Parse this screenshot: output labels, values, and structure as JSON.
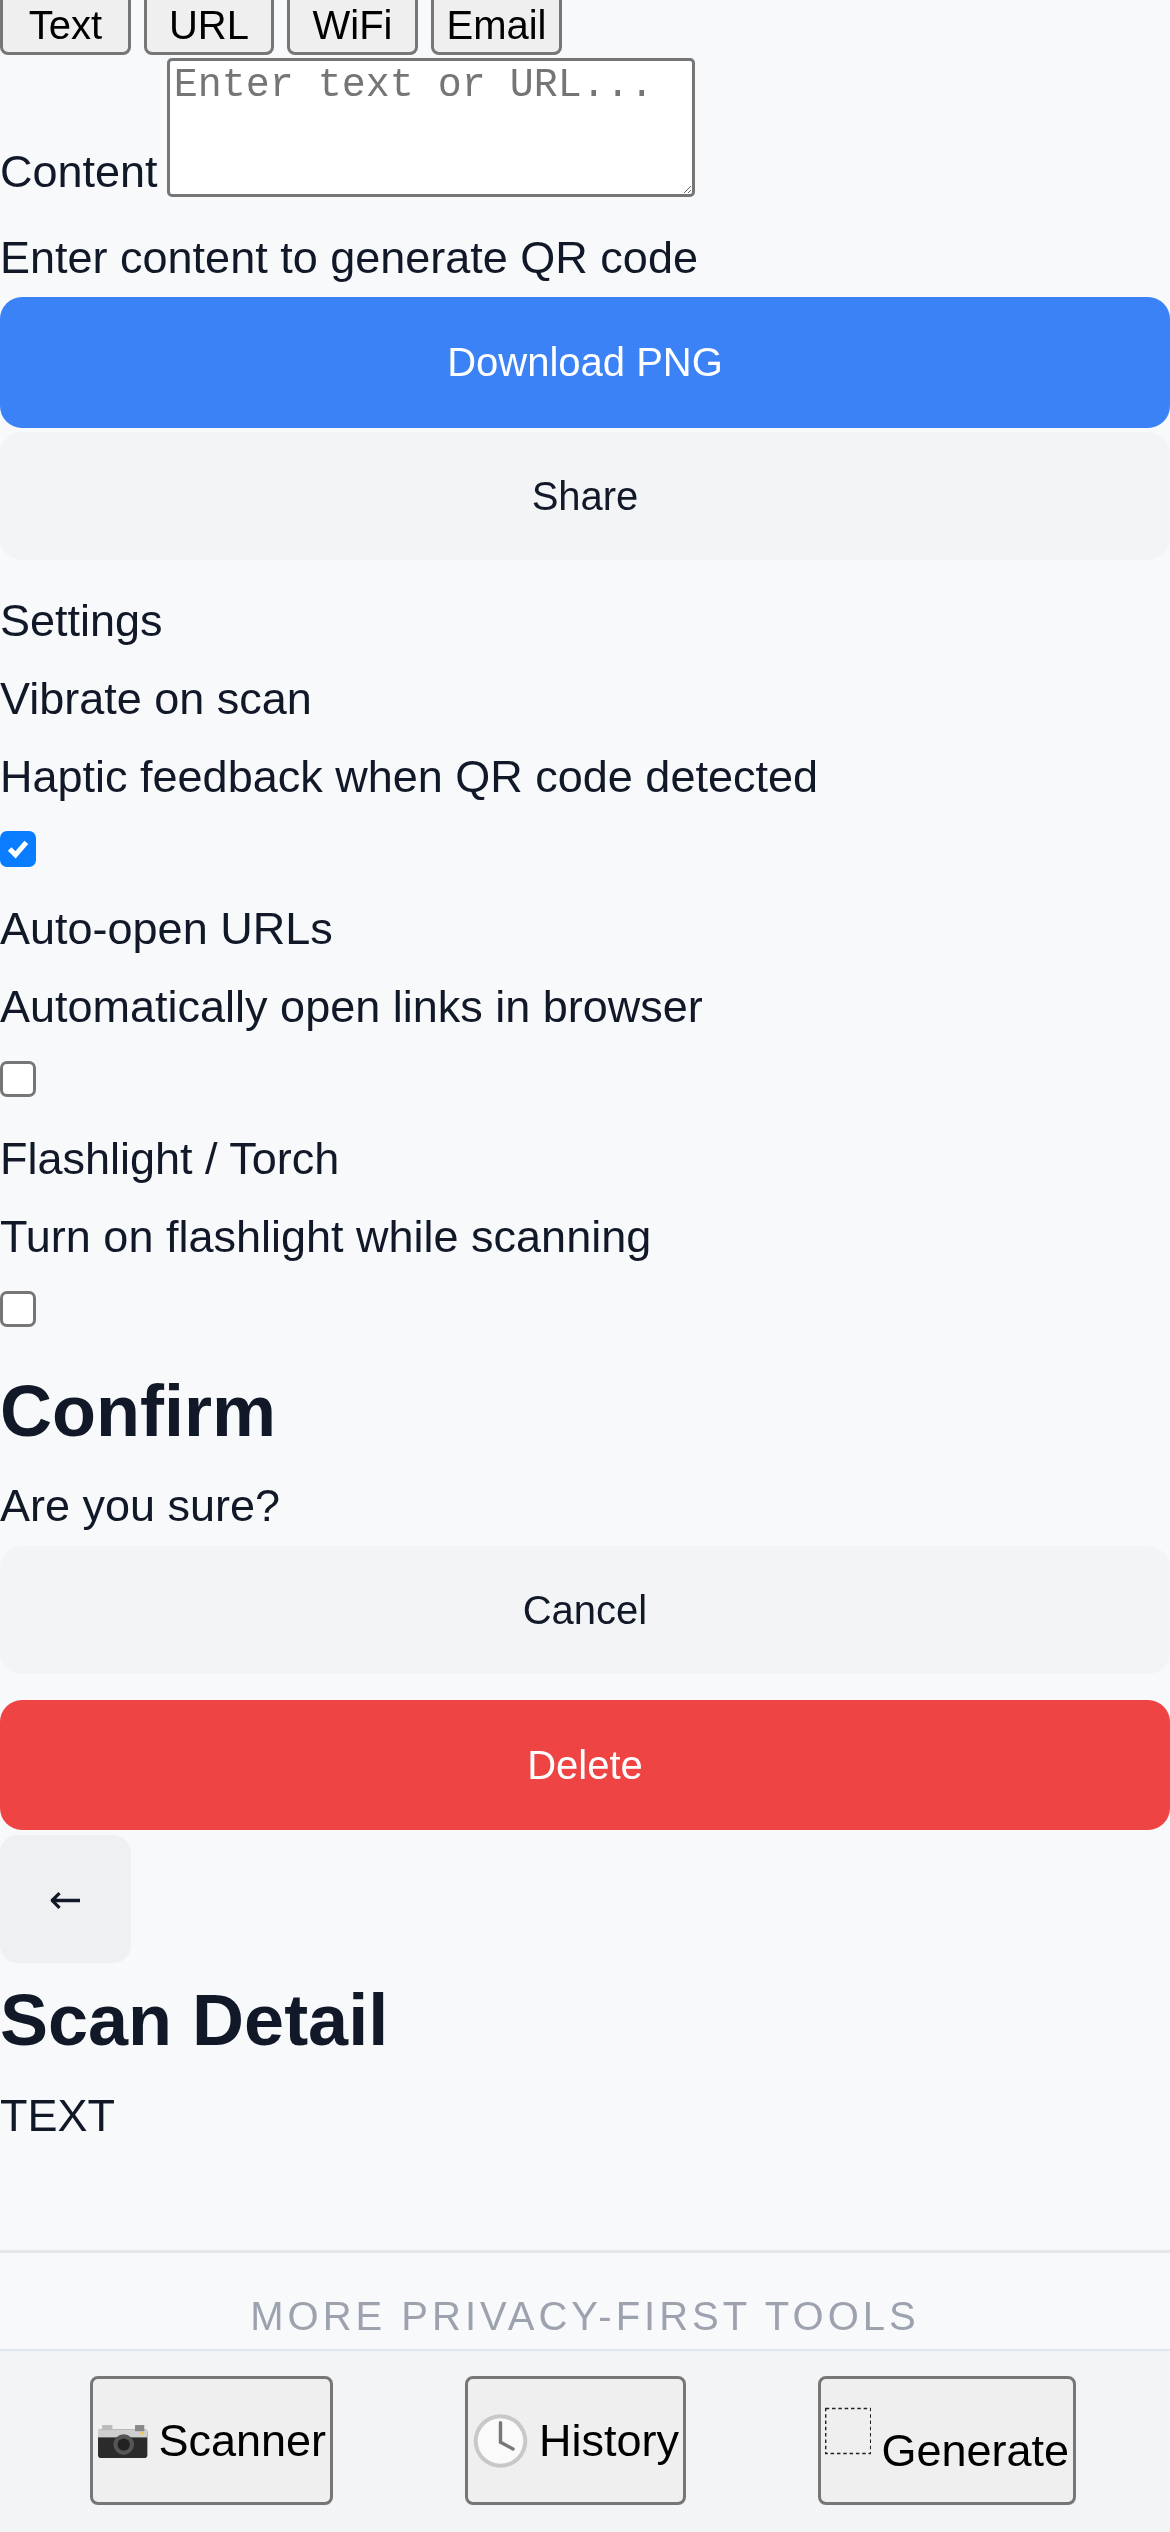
{
  "type_tabs": [
    {
      "label": "Text"
    },
    {
      "label": "URL"
    },
    {
      "label": "WiFi"
    },
    {
      "label": "Email"
    }
  ],
  "generator": {
    "content_label": "Content",
    "placeholder": "Enter text or URL...",
    "hint": "Enter content to generate QR code",
    "download_button": "Download PNG",
    "share_button": "Share"
  },
  "settings": {
    "title": "Settings",
    "items": [
      {
        "label": "Vibrate on scan",
        "description": "Haptic feedback when QR code detected",
        "checked": true
      },
      {
        "label": "Auto-open URLs",
        "description": "Automatically open links in browser",
        "checked": false
      },
      {
        "label": "Flashlight / Torch",
        "description": "Turn on flashlight while scanning",
        "checked": false
      }
    ]
  },
  "confirm_dialog": {
    "title": "Confirm",
    "message": "Are you sure?",
    "cancel_button": "Cancel",
    "delete_button": "Delete"
  },
  "scan_detail": {
    "back_button": "←",
    "title": "Scan Detail",
    "type": "TEXT"
  },
  "footer": {
    "heading": "MORE PRIVACY-FIRST TOOLS"
  },
  "bottom_nav": [
    {
      "label": "Scanner",
      "kind": "camera"
    },
    {
      "label": "History",
      "kind": "clock"
    },
    {
      "label": "Generate",
      "kind": "blank"
    }
  ]
}
